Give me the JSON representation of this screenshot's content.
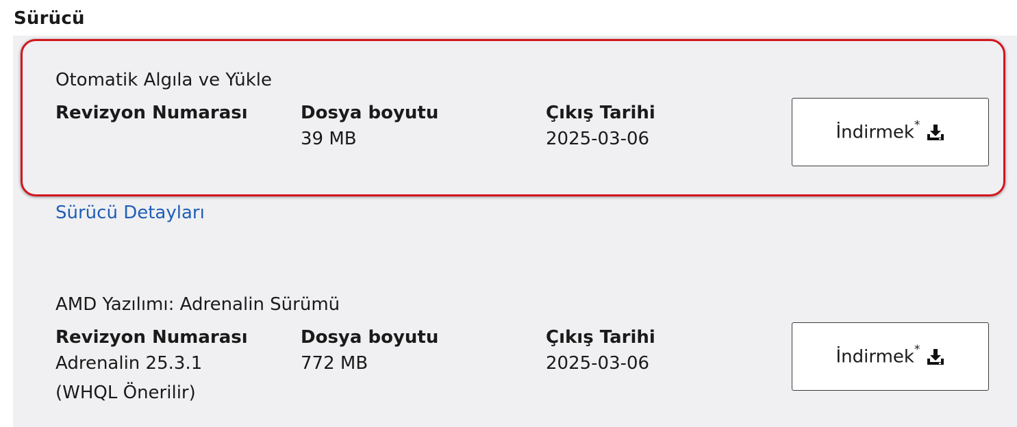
{
  "section": {
    "title": "Sürücü"
  },
  "auto_detect": {
    "title": "Otomatik Algıla ve Yükle",
    "revision_header": "Revizyon Numarası",
    "revision_value": "",
    "size_header": "Dosya boyutu",
    "size_value": "39 MB",
    "date_header": "Çıkış Tarihi",
    "date_value": "2025-03-06",
    "download_label": "İndirmek",
    "download_mark": "*",
    "download_icon": "download-icon"
  },
  "driver_details_link": "Sürücü Detayları",
  "adrenalin": {
    "title": "AMD Yazılımı: Adrenalin Sürümü",
    "revision_header": "Revizyon Numarası",
    "revision_value_line1": "Adrenalin 25.3.1",
    "revision_value_line2": "(WHQL Önerilir)",
    "size_header": "Dosya boyutu",
    "size_value": "772 MB",
    "date_header": "Çıkış Tarihi",
    "date_value": "2025-03-06",
    "download_label": "İndirmek",
    "download_mark": "*",
    "download_icon": "download-icon"
  },
  "colors": {
    "highlight_border": "#d4141c",
    "link": "#1f5eb5",
    "panel_bg": "#f0f0f2"
  }
}
